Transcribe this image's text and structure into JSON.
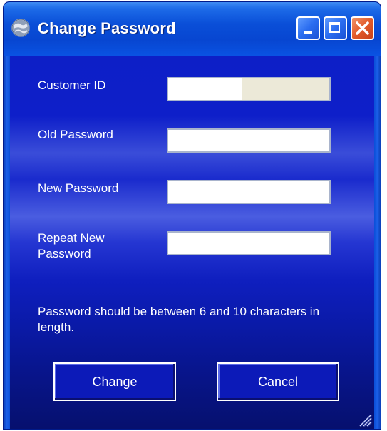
{
  "window": {
    "title": "Change Password"
  },
  "form": {
    "customer_id": {
      "label": "Customer ID",
      "value": ""
    },
    "old_password": {
      "label": "Old Password",
      "value": ""
    },
    "new_password": {
      "label": "New Password",
      "value": ""
    },
    "repeat_password": {
      "label_line1": "Repeat New",
      "label_line2": "Password",
      "value": ""
    }
  },
  "note": {
    "text": "Password should be between 6  and 10 characters in length."
  },
  "buttons": {
    "change_label": "Change",
    "cancel_label": "Cancel"
  },
  "colors": {
    "title_bar": "#0a4fd8",
    "client_bg": "#0e1fc9",
    "close_button": "#e25a2a"
  },
  "icons": {
    "app": "globe-icon",
    "minimize": "minimize-icon",
    "maximize": "maximize-icon",
    "close": "close-icon",
    "resize": "resize-grip-icon"
  }
}
